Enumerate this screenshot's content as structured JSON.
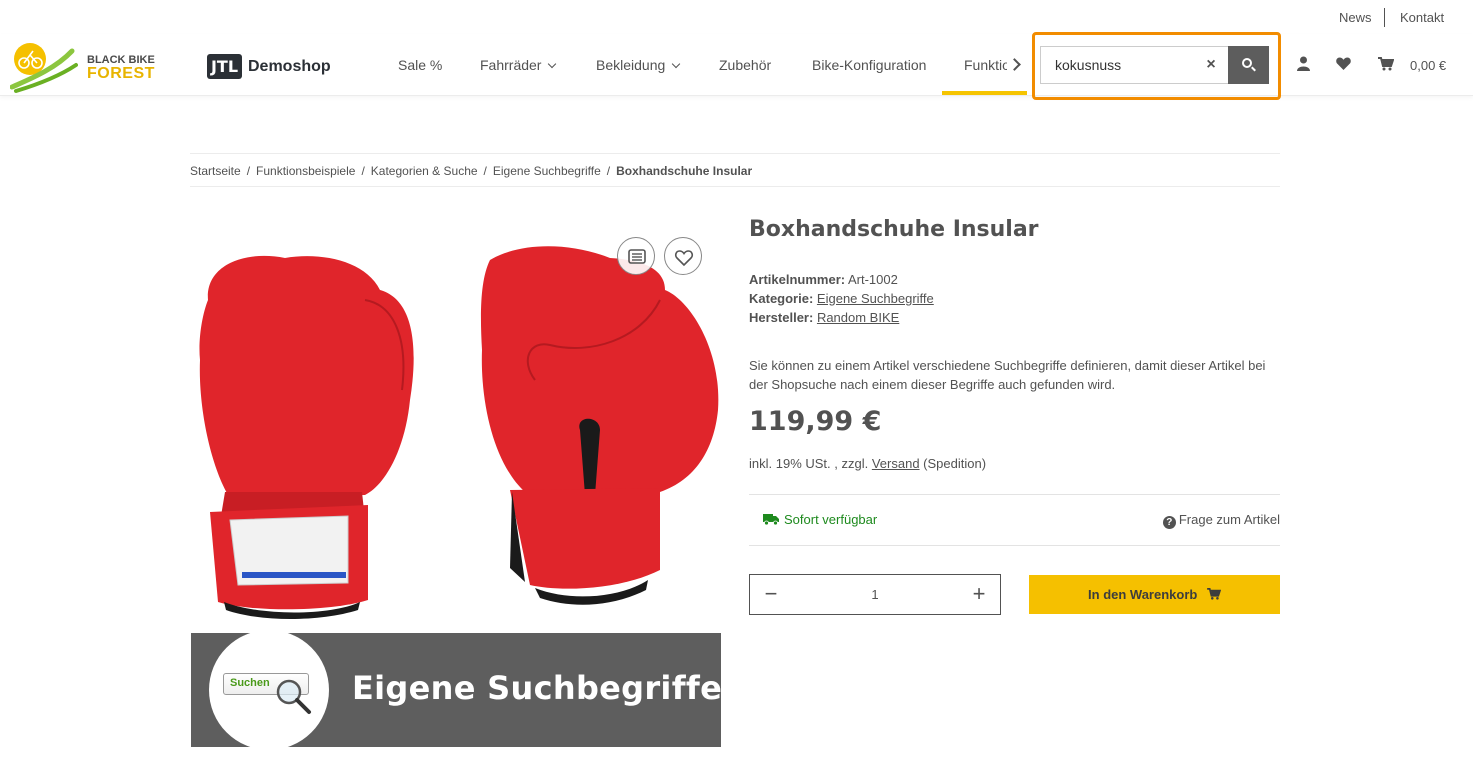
{
  "topbar": {
    "news": "News",
    "kontakt": "Kontakt"
  },
  "brand": {
    "line1": "BLACK BIKE",
    "line2": "FOREST",
    "jtl_mark": "JTL",
    "shop_name": "Demoshop"
  },
  "nav": {
    "items": [
      {
        "label": "Sale %",
        "dropdown": false
      },
      {
        "label": "Fahrräder",
        "dropdown": true
      },
      {
        "label": "Bekleidung",
        "dropdown": true
      },
      {
        "label": "Zubehör",
        "dropdown": false
      },
      {
        "label": "Bike-Konfiguration",
        "dropdown": false
      },
      {
        "label": "Funktio",
        "dropdown": false,
        "active": true
      }
    ]
  },
  "search": {
    "value": "kokusnuss",
    "clear": "×"
  },
  "header": {
    "cart_total": "0,00 €",
    "icons": [
      "user-icon",
      "heart-icon",
      "cart-icon"
    ]
  },
  "breadcrumb": {
    "items": [
      "Startseite",
      "Funktionsbeispiele",
      "Kategorien & Suche",
      "Eigene Suchbegriffe",
      "Boxhandschuhe Insular"
    ],
    "separator": "/"
  },
  "banner": {
    "search_word": "Suchen",
    "title": "Eigene Suchbegriffe"
  },
  "product": {
    "title": "Boxhandschuhe Insular",
    "sku_label": "Artikelnummer:",
    "sku": "Art-1002",
    "category_label": "Kategorie:",
    "category": "Eigene Suchbegriffe",
    "manufacturer_label": "Hersteller:",
    "manufacturer": "Random BIKE",
    "description": "Sie können zu einem Artikel verschiedene Suchbegriffe definieren, damit dieser Artikel bei der Shopsuche nach einem dieser Begriffe auch gefunden wird.",
    "price": "119,99 €",
    "tax_prefix": "inkl. 19% USt. , zzgl.",
    "shipping_link": "Versand",
    "shipping_suffix": "(Spedition)",
    "availability": "Sofort verfügbar",
    "question": "Frage zum Artikel",
    "quantity": "1",
    "add_to_cart": "In den Warenkorb"
  },
  "colors": {
    "accent": "#f5c000",
    "search_highlight": "#f28c00",
    "stock": "#1e8a1e",
    "glove": "#e0252b"
  }
}
